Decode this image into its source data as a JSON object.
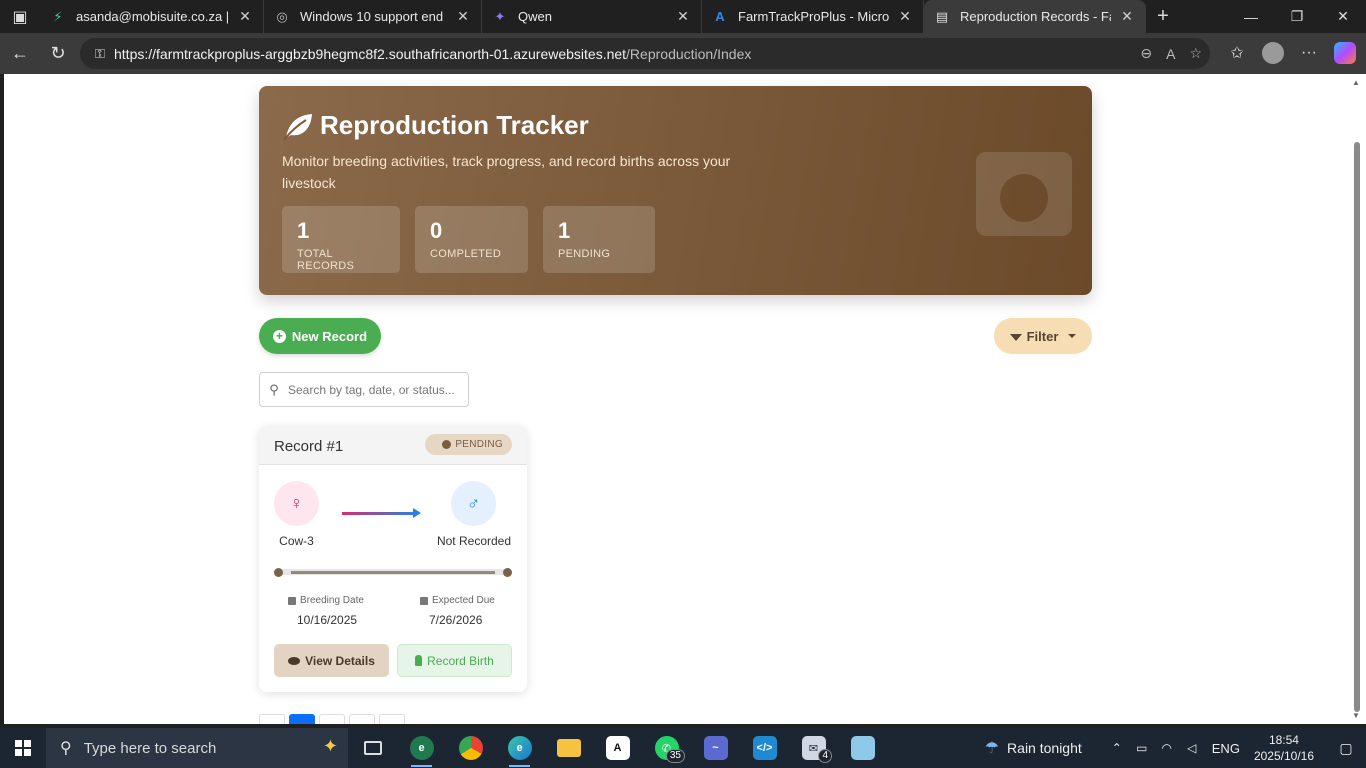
{
  "browser": {
    "tabs": [
      {
        "title": "asanda@mobisuite.co.za | Mo",
        "icon": "lightning-icon",
        "active": false
      },
      {
        "title": "Windows 10 support end",
        "icon": "globe-icon",
        "active": false
      },
      {
        "title": "Qwen",
        "icon": "qwen-icon",
        "active": false
      },
      {
        "title": "FarmTrackProPlus - Microsoft",
        "icon": "azure-icon",
        "active": false
      },
      {
        "title": "Reproduction Records - Farm",
        "icon": "document-icon",
        "active": true
      }
    ],
    "url_host": "https://farmtrackproplus-arggbzb9hegmc8f2.southafricanorth-01.azurewebsites.net",
    "url_path": "/Reproduction/Index"
  },
  "hero": {
    "title": "Reproduction Tracker",
    "subtitle": "Monitor breeding activities, track progress, and record births across your livestock",
    "stats": [
      {
        "value": "1",
        "label": "TOTAL RECORDS"
      },
      {
        "value": "0",
        "label": "COMPLETED"
      },
      {
        "value": "1",
        "label": "PENDING"
      }
    ]
  },
  "actions": {
    "new_label": "New Record",
    "filter_label": "Filter",
    "search_placeholder": "Search by tag, date, or status..."
  },
  "record": {
    "title": "Record #1",
    "status": "PENDING",
    "female": "Cow-3",
    "male": "Not Recorded",
    "breeding_label": "Breeding Date",
    "breeding_date": "10/16/2025",
    "due_label": "Expected Due",
    "due_date": "7/26/2026",
    "view_label": "View Details",
    "birth_label": "Record Birth"
  },
  "pagination": {
    "active_page_index": 1
  },
  "taskbar": {
    "search_placeholder": "Type here to search",
    "whatsapp_count": "35",
    "mail_count": "4",
    "weather": "Rain tonight",
    "language": "ENG",
    "time": "18:54",
    "date": "2025/10/16"
  }
}
